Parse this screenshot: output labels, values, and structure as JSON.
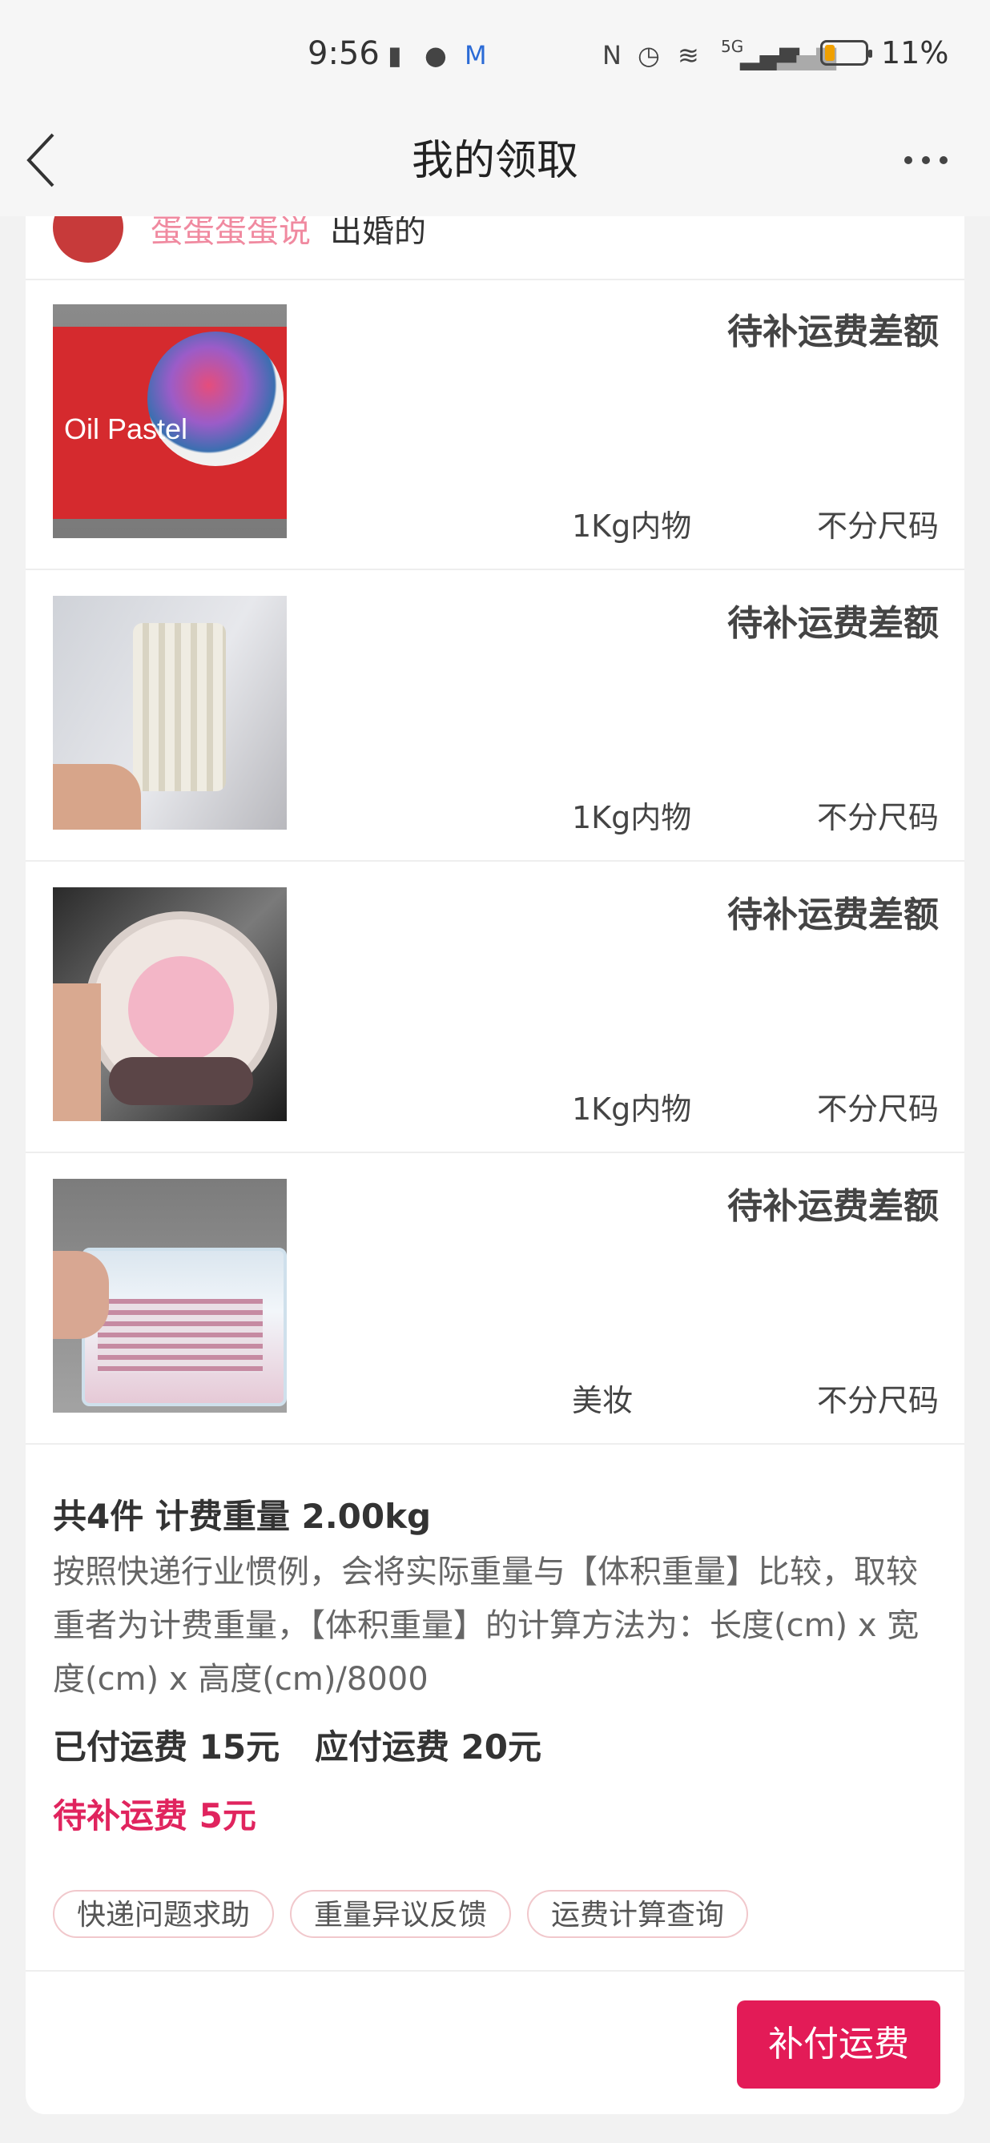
{
  "status_bar": {
    "time": "9:56",
    "network": "5G",
    "battery": "11%",
    "icons": [
      "sim-alert-icon",
      "wechat-icon",
      "mail-icon",
      "nfc-icon",
      "alarm-icon",
      "wifi-icon",
      "signal-icon",
      "signal-2-icon",
      "battery-icon"
    ]
  },
  "nav": {
    "title": "我的领取",
    "back_icon": "back-chevron-icon",
    "more_icon": "more-icon"
  },
  "header_strip": {
    "nickname": "蛋蛋蛋蛋说",
    "action": "出婚的"
  },
  "items": [
    {
      "image": "oil-pastel-box",
      "image_text": "Oil Pastel",
      "status": "待补运费差额",
      "spec": "1Kg内物",
      "size": "不分尺码"
    },
    {
      "image": "white-woven-cup",
      "status": "待补运费差额",
      "spec": "1Kg内物",
      "size": "不分尺码"
    },
    {
      "image": "cartoon-mousepad",
      "status": "待补运费差额",
      "spec": "1Kg内物",
      "size": "不分尺码"
    },
    {
      "image": "eyelash-case",
      "status": "待补运费差额",
      "spec": "美妆",
      "size": "不分尺码"
    }
  ],
  "summary": {
    "count_weight": "共4件 计费重量 2.00kg",
    "description": "按照快递行业惯例，会将实际重量与【体积重量】比较，取较重者为计费重量，【体积重量】的计算方法为：长度(cm) x 宽度(cm) x 高度(cm)/8000",
    "paid_due": "已付运费 15元   应付运费 20元",
    "pending": "待补运费 5元"
  },
  "chips": [
    "快递问题求助",
    "重量异议反馈",
    "运费计算查询"
  ],
  "pay_button": "补付运费",
  "colors": {
    "accent": "#e31b57",
    "pending_text": "#e0245e",
    "chip_border": "#f1c8cc"
  }
}
